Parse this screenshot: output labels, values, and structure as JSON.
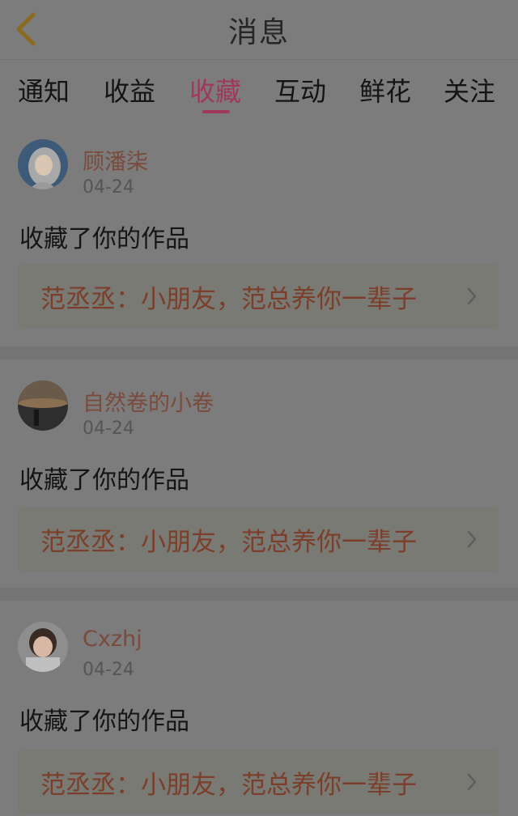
{
  "header": {
    "title": "消息",
    "back_icon": "chevron-left-icon"
  },
  "tabs": [
    {
      "label": "通知"
    },
    {
      "label": "收益"
    },
    {
      "label": "收藏"
    },
    {
      "label": "互动"
    },
    {
      "label": "鲜花"
    },
    {
      "label": "关注"
    }
  ],
  "active_tab": "收藏",
  "colors": {
    "accent": "#a0385c",
    "username": "#7a4a3c",
    "quote_text": "#7b3e2a"
  },
  "feed": [
    {
      "username": "顾潘柒",
      "date": "04-24",
      "action": "收藏了你的作品",
      "work": "范丞丞：小朋友，范总养你一辈子"
    },
    {
      "username": "自然卷的小卷",
      "date": "04-24",
      "action": "收藏了你的作品",
      "work": "范丞丞：小朋友，范总养你一辈子"
    },
    {
      "username": "Cxzhj",
      "date": "04-24",
      "action": "收藏了你的作品",
      "work": "范丞丞：小朋友，范总养你一辈子"
    }
  ]
}
